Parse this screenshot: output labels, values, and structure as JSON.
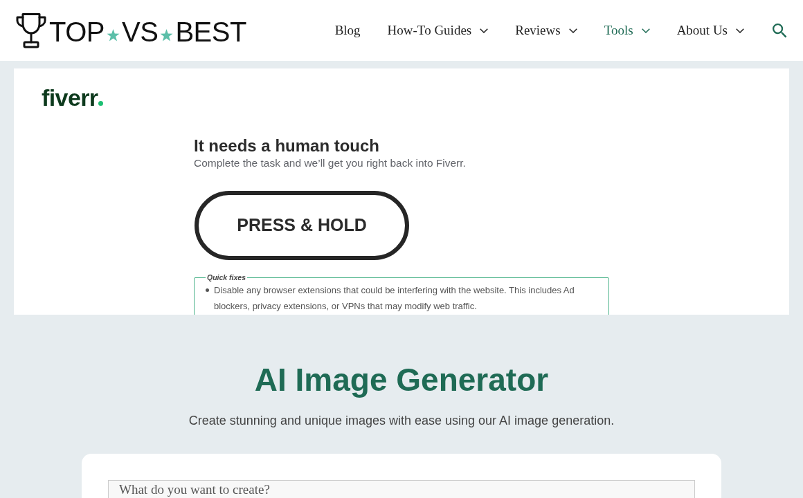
{
  "header": {
    "logo": {
      "words": [
        "TOP",
        "VS",
        "BEST"
      ]
    },
    "nav": [
      {
        "label": "Blog",
        "has_menu": false,
        "selected": false
      },
      {
        "label": "How-To Guides",
        "has_menu": true,
        "selected": false
      },
      {
        "label": "Reviews",
        "has_menu": true,
        "selected": false
      },
      {
        "label": "Tools",
        "has_menu": true,
        "selected": true
      },
      {
        "label": "About Us",
        "has_menu": true,
        "selected": false
      }
    ]
  },
  "captcha_frame": {
    "brand": "fiverr",
    "title": "It needs a human touch",
    "subtitle": "Complete the task and we’ll get you right back into Fiverr.",
    "button": "PRESS & HOLD",
    "quick_fixes": {
      "legend": "Quick fixes",
      "items": [
        "Disable any browser extensions that could be interfering with the website. This includes Ad blockers, privacy extensions, or VPNs that may modify web traffic."
      ]
    }
  },
  "generator": {
    "title": "AI Image Generator",
    "subtitle": "Create stunning and unique images with ease using our AI image generation.",
    "prompt": {
      "placeholder": "What do you want to create?"
    }
  }
}
